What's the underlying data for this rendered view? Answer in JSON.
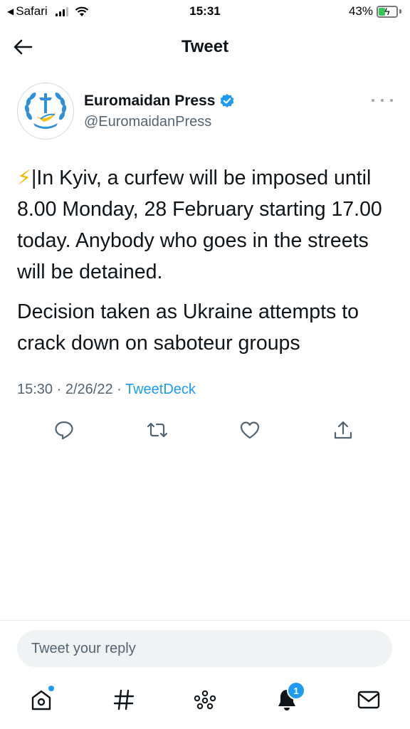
{
  "status_bar": {
    "back_app": "Safari",
    "time": "15:31",
    "battery": "43%",
    "battery_level": 0.43
  },
  "header": {
    "title": "Tweet"
  },
  "author": {
    "name": "Euromaidan Press",
    "handle": "@EuromaidanPress",
    "verified": true
  },
  "tweet": {
    "bolt": "⚡",
    "paragraph1": "|In Kyiv, a curfew will be imposed until 8.00 Monday, 28 February starting 17.00 today. Anybody who goes in the streets will be detained.",
    "paragraph2": "Decision taken as Ukraine attempts to crack down on saboteur groups",
    "time": "15:30",
    "date": "2/26/22",
    "source": "TweetDeck",
    "separator": " · "
  },
  "reply": {
    "placeholder": "Tweet your reply"
  },
  "tabbar": {
    "notification_count": "1"
  },
  "colors": {
    "accent": "#1d9bf0",
    "text": "#0f1419",
    "muted": "#536471",
    "icon": "#536471"
  }
}
